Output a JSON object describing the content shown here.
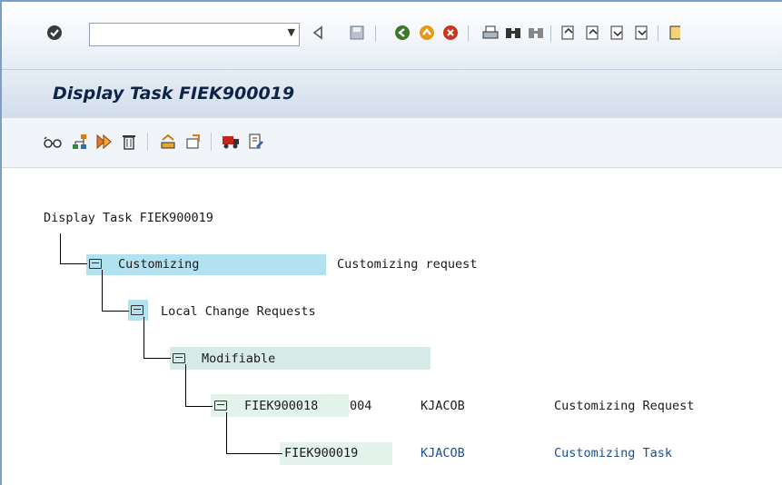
{
  "toolbar": {
    "command_field_value": "",
    "icons": [
      "enter-icon",
      "back-icon",
      "save-icon",
      "back-nav-icon",
      "exit-icon",
      "cancel-icon",
      "print-icon",
      "find-icon",
      "find-next-icon",
      "first-page-icon",
      "previous-page-icon",
      "next-page-icon",
      "last-page-icon"
    ]
  },
  "title_bar": {
    "title": "Display Task FIEK900019"
  },
  "tree": {
    "root": "Display Task FIEK900019",
    "customizing": {
      "label": "Customizing",
      "desc": "Customizing request"
    },
    "local": {
      "label": "Local Change Requests"
    },
    "modifiable": {
      "label": "Modifiable"
    },
    "request": {
      "id": "FIEK900018",
      "client": "004",
      "owner": "KJACOB",
      "desc": "Customizing Request"
    },
    "task": {
      "id": "FIEK900019",
      "owner": "KJACOB",
      "desc": "Customizing Task"
    }
  },
  "colors": {
    "accent": "#1b4f94",
    "highlight": "#b2e2f0"
  }
}
